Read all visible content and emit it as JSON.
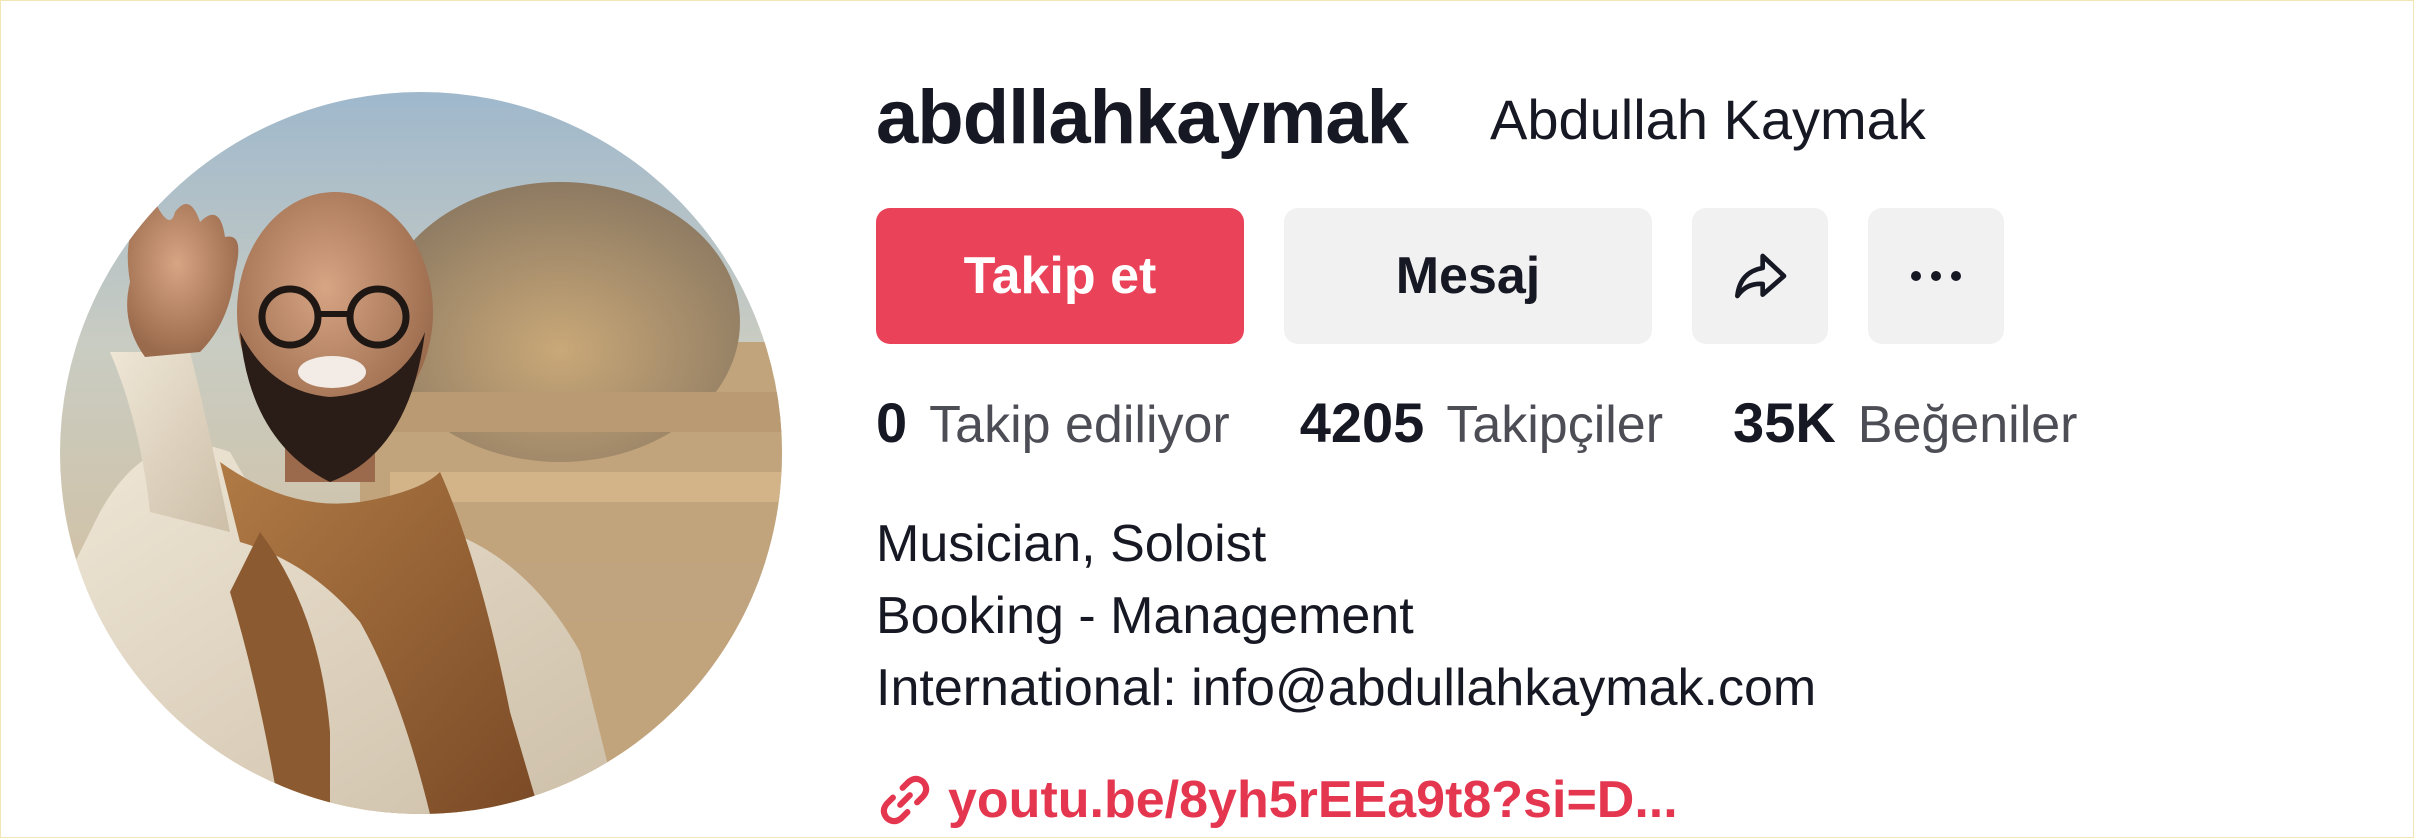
{
  "profile": {
    "username": "abdllahkaymak",
    "display_name": "Abdullah Kaymak"
  },
  "actions": {
    "follow_label": "Takip et",
    "message_label": "Mesaj",
    "share_icon": "share-arrow-icon",
    "more_icon": "more-dots-icon"
  },
  "stats": {
    "following_count": "0",
    "following_label": "Takip ediliyor",
    "followers_count": "4205",
    "followers_label": "Takipçiler",
    "likes_count": "35K",
    "likes_label": "Beğeniler"
  },
  "bio": {
    "line1": "Musician, Soloist",
    "line2": "Booking - Management",
    "line3": "International: info@abdullahkaymak.com"
  },
  "link": {
    "text": "youtu.be/8yh5rEEa9t8?si=D...",
    "icon": "link-icon"
  },
  "colors": {
    "accent": "#ea4359",
    "link": "#e4364f",
    "secondary_button": "#f1f1f2"
  }
}
